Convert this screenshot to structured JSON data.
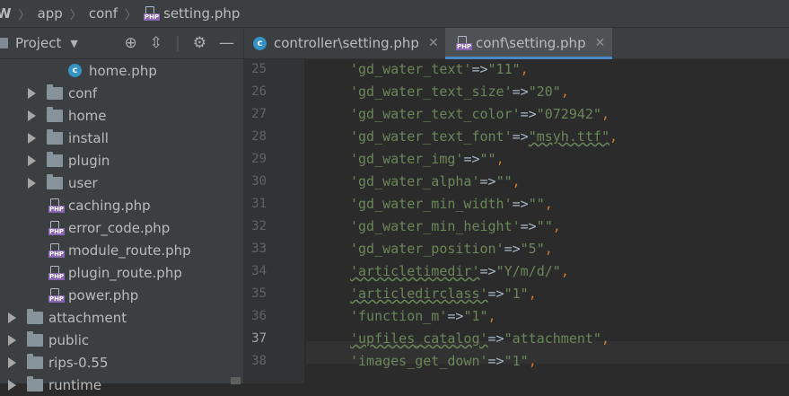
{
  "breadcrumb": {
    "items": [
      "W",
      "app",
      "conf",
      "setting.php"
    ]
  },
  "sidebar": {
    "title": "Project",
    "tree": [
      {
        "label": "home.php",
        "kind": "class"
      },
      {
        "label": "conf",
        "kind": "folder"
      },
      {
        "label": "home",
        "kind": "folder"
      },
      {
        "label": "install",
        "kind": "folder"
      },
      {
        "label": "plugin",
        "kind": "folder"
      },
      {
        "label": "user",
        "kind": "folder"
      },
      {
        "label": "caching.php",
        "kind": "php"
      },
      {
        "label": "error_code.php",
        "kind": "php"
      },
      {
        "label": "module_route.php",
        "kind": "php"
      },
      {
        "label": "plugin_route.php",
        "kind": "php"
      },
      {
        "label": "power.php",
        "kind": "php"
      },
      {
        "label": "attachment",
        "kind": "folder"
      },
      {
        "label": "public",
        "kind": "folder"
      },
      {
        "label": "rips-0.55",
        "kind": "folder"
      },
      {
        "label": "runtime",
        "kind": "folder"
      }
    ]
  },
  "tabs": [
    {
      "label": "controller\\setting.php",
      "icon": "class-icon",
      "active": false
    },
    {
      "label": "conf\\setting.php",
      "icon": "php-icon",
      "active": true
    }
  ],
  "editor": {
    "current_line": "37",
    "lines": [
      {
        "num": "25",
        "key": "'gd_water_text'",
        "value": "\"11\""
      },
      {
        "num": "26",
        "key": "'gd_water_text_size'",
        "value": "\"20\""
      },
      {
        "num": "27",
        "key": "'gd_water_text_color'",
        "value": "\"072942\""
      },
      {
        "num": "28",
        "key": "'gd_water_text_font'",
        "value": "\"msyh.ttf\""
      },
      {
        "num": "29",
        "key": "'gd_water_img'",
        "value": "\"\""
      },
      {
        "num": "30",
        "key": "'gd_water_alpha'",
        "value": "\"\""
      },
      {
        "num": "31",
        "key": "'gd_water_min_width'",
        "value": "\"\""
      },
      {
        "num": "32",
        "key": "'gd_water_min_height'",
        "value": "\"\""
      },
      {
        "num": "33",
        "key": "'gd_water_position'",
        "value": "\"5\""
      },
      {
        "num": "34",
        "key": "'articletimedir'",
        "value": "\"Y/m/d/\""
      },
      {
        "num": "35",
        "key": "'articledirclass'",
        "value": "\"1\""
      },
      {
        "num": "36",
        "key": "'function_m'",
        "value": "\"1\""
      },
      {
        "num": "37",
        "key": "'upfiles_catalog'",
        "value": "\"attachment\""
      },
      {
        "num": "38",
        "key": "'images_get_down'",
        "value": "\"1\""
      }
    ],
    "arrow_op": "=>",
    "comma": ","
  }
}
